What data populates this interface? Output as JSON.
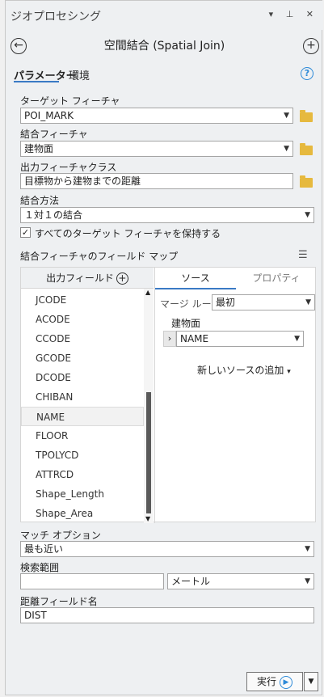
{
  "pane": {
    "title": "ジオプロセシング",
    "controls": "▾ ⊥ ✕"
  },
  "tool": {
    "title": "空間結合 (Spatial Join)"
  },
  "tabs": [
    {
      "label": "パラメーター"
    },
    {
      "label": "環境"
    }
  ],
  "help": "?",
  "params": {
    "target": {
      "label": "ターゲット フィーチャ",
      "value": "POI_MARK"
    },
    "join": {
      "label": "結合フィーチャ",
      "value": "建物面"
    },
    "output": {
      "label": "出力フィーチャクラス",
      "value": "目標物から建物までの距離"
    },
    "method": {
      "label": "結合方法",
      "value": "１対１の結合"
    },
    "keep_all": {
      "label": "すべてのターゲット フィーチャを保持する",
      "checked": "✓"
    }
  },
  "field_map": {
    "label": "結合フィーチャのフィールド マップ",
    "output_fields_label": "出力フィールド",
    "fields": [
      "JCODE",
      "ACODE",
      "CCODE",
      "GCODE",
      "DCODE",
      "CHIBAN",
      "NAME",
      "FLOOR",
      "TPOLYCD",
      "ATTRCD",
      "Shape_Length",
      "Shape_Area"
    ],
    "selected_field": "NAME",
    "tab_source": "ソース",
    "tab_properties": "プロパティ",
    "merge_rule_label": "マージ ルール",
    "merge_rule_value": "最初",
    "source_group": "建物面",
    "source_field": "NAME",
    "add_source": "新しいソースの追加"
  },
  "match": {
    "label": "マッチ オプション",
    "value": "最も近い"
  },
  "search_radius": {
    "label": "検索範囲",
    "value": "",
    "unit": "メートル"
  },
  "distance_field": {
    "label": "距離フィールド名",
    "value": "DIST"
  },
  "run": {
    "label": "実行"
  }
}
